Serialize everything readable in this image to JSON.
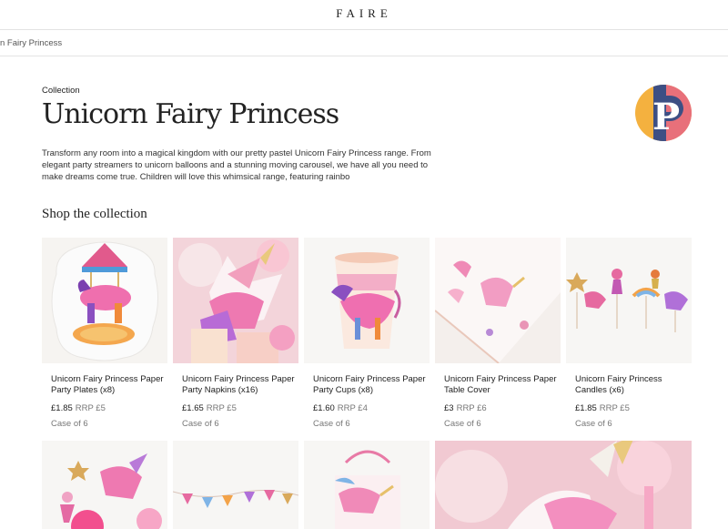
{
  "header": {
    "brand": "FAIRE"
  },
  "breadcrumb": {
    "text": "n Fairy Princess"
  },
  "collection": {
    "eyebrow": "Collection",
    "title": "Unicorn Fairy Princess",
    "description": "Transform any room into a magical kingdom with our pretty pastel Unicorn Fairy Princess range. From elegant party streamers to unicorn balloons and a stunning moving carousel, we have all you need to make dreams come true. Children will love this whimsical range, featuring rainbo"
  },
  "brand_logo": {
    "letter": "P",
    "colors": [
      "#f4b13f",
      "#e8707a",
      "#3d4f84"
    ]
  },
  "shop": {
    "heading": "Shop the collection"
  },
  "products": [
    {
      "name": "Unicorn Fairy Princess Paper Party Plates (x8)",
      "price": "£1.85",
      "rrp": "RRP £5",
      "case": "Case of 6",
      "image_icon": "carousel-plate-image"
    },
    {
      "name": "Unicorn Fairy Princess Paper Party Napkins (x16)",
      "price": "£1.65",
      "rrp": "RRP £5",
      "case": "Case of 6",
      "image_icon": "unicorn-napkins-image"
    },
    {
      "name": "Unicorn Fairy Princess Paper Party Cups (x8)",
      "price": "£1.60",
      "rrp": "RRP £4",
      "case": "Case of 6",
      "image_icon": "party-cup-image"
    },
    {
      "name": "Unicorn Fairy Princess Paper Table Cover",
      "price": "£3",
      "rrp": "RRP £6",
      "case": "Case of 6",
      "image_icon": "table-cover-image"
    },
    {
      "name": "Unicorn Fairy Princess Candles (x6)",
      "price": "£1.85",
      "rrp": "RRP £5",
      "case": "Case of 6",
      "image_icon": "candles-image"
    }
  ],
  "row2_icons": [
    "hanging-decorations-image",
    "garland-image",
    "party-bag-image",
    "unicorn-closeup-image"
  ]
}
